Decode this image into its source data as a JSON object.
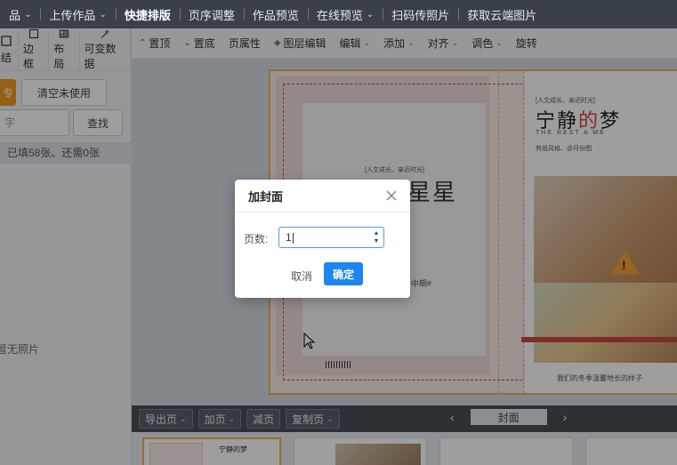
{
  "topnav": {
    "items": [
      {
        "label": "品",
        "has_caret": true
      },
      {
        "label": "上传作品",
        "has_caret": true
      },
      {
        "label": "快捷排版",
        "has_caret": false,
        "active": true
      },
      {
        "label": "页序调整",
        "has_caret": false
      },
      {
        "label": "作品预览",
        "has_caret": false
      },
      {
        "label": "在线预览",
        "has_caret": true
      },
      {
        "label": "扫码传照片",
        "has_caret": false
      },
      {
        "label": "获取云端图片",
        "has_caret": false
      }
    ]
  },
  "left_panel": {
    "tools": [
      {
        "label": "结",
        "icon": "tool-icon"
      },
      {
        "label": "边框",
        "icon": "square-icon"
      },
      {
        "label": "布局",
        "icon": "layout-icon"
      },
      {
        "label": "可变数据",
        "icon": "wand-icon"
      }
    ],
    "primary_button": "专",
    "clear_unused_button": "清空未使用",
    "search_placeholder": "字",
    "search_button": "查找",
    "fill_status": "已填58张、还需0张",
    "empty_text": "暂无照片"
  },
  "toolbar": {
    "items": [
      {
        "label": "置顶",
        "icon": "arrow-up-icon",
        "has_caret": false
      },
      {
        "label": "置底",
        "icon": "arrow-down-icon",
        "has_caret": false
      },
      {
        "label": "页属性",
        "icon": "",
        "has_caret": false
      },
      {
        "label": "图层编辑",
        "icon": "layers-icon",
        "has_caret": false
      },
      {
        "label": "编辑",
        "icon": "",
        "has_caret": true
      },
      {
        "label": "添加",
        "icon": "",
        "has_caret": true
      },
      {
        "label": "对齐",
        "icon": "",
        "has_caret": true
      },
      {
        "label": "调色",
        "icon": "",
        "has_caret": true
      },
      {
        "label": "旋转",
        "icon": "",
        "has_caret": false
      }
    ]
  },
  "canvas": {
    "front_cover": {
      "tagline": "[人文成长、亲近时光]",
      "title_part1": "宁静",
      "title_accent": "的",
      "title_part2": "梦",
      "subtitle": "THE REST  A  ME",
      "author_line": "剪纸风格、@月份图",
      "caption": "我们的冬季温馨地长的样子"
    },
    "back_cover": {
      "tagline": "[人文成长、亲近时光]",
      "title": "星星",
      "side_text": "中期#"
    }
  },
  "pagebar": {
    "export_label": "导出页",
    "add_label": "加页",
    "remove_label": "减页",
    "copy_label": "复制页",
    "page_name": "封面"
  },
  "thumbnails": {
    "first_title": "宁静的梦"
  },
  "dialog": {
    "title": "加封面",
    "page_count_label": "页数:",
    "page_count_value": "1",
    "cancel_label": "取消",
    "ok_label": "确定"
  },
  "colors": {
    "accent_orange": "#f39c1f",
    "primary_blue": "#1e86f0",
    "nav_bg": "#3a4048",
    "title_red": "#d4453a"
  }
}
